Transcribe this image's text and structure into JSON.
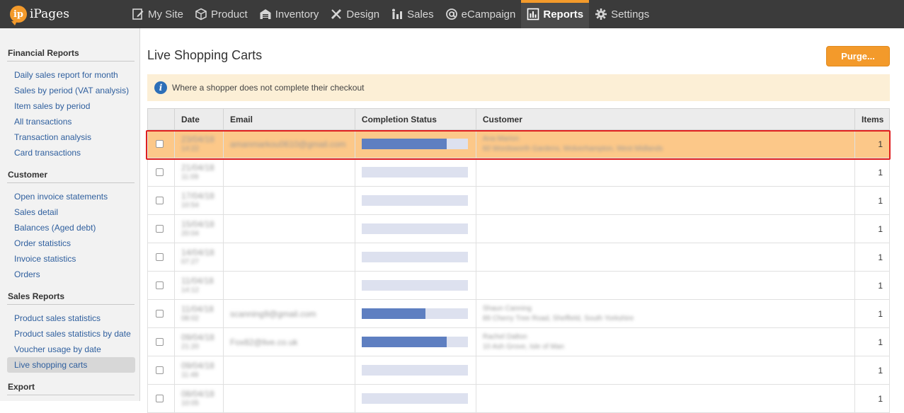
{
  "app": {
    "name": "iPages",
    "logo_initials": "ip"
  },
  "nav": [
    {
      "label": "My Site",
      "icon": "edit-page-icon"
    },
    {
      "label": "Product",
      "icon": "box-icon"
    },
    {
      "label": "Inventory",
      "icon": "warehouse-icon"
    },
    {
      "label": "Design",
      "icon": "pencil-ruler-icon"
    },
    {
      "label": "Sales",
      "icon": "sales-icon"
    },
    {
      "label": "eCampaign",
      "icon": "at-sign-icon"
    },
    {
      "label": "Reports",
      "icon": "bar-chart-icon",
      "active": true
    },
    {
      "label": "Settings",
      "icon": "gear-icon"
    }
  ],
  "sidebar": {
    "sections": [
      {
        "heading": "Financial Reports",
        "items": [
          "Daily sales report for month",
          "Sales by period (VAT analysis)",
          "Item sales by period",
          "All transactions",
          "Transaction analysis",
          "Card transactions"
        ]
      },
      {
        "heading": "Customer",
        "items": [
          "Open invoice statements",
          "Sales detail",
          "Balances (Aged debt)",
          "Order statistics",
          "Invoice statistics",
          "Orders"
        ]
      },
      {
        "heading": "Sales Reports",
        "items": [
          "Product sales statistics",
          "Product sales statistics by date",
          "Voucher usage by date",
          "Live shopping carts"
        ]
      },
      {
        "heading": "Export",
        "items": []
      }
    ],
    "active_item": "Live shopping carts"
  },
  "main": {
    "title": "Live Shopping Carts",
    "purge_label": "Purge...",
    "info_text": "Where a shopper does not complete their checkout",
    "columns": [
      "",
      "Date",
      "Email",
      "Completion Status",
      "Customer",
      "Items"
    ],
    "rows": [
      {
        "date": "23/04/18",
        "time": "14:22",
        "email": "amanmarkou0610@gmail.com",
        "completion": 0.8,
        "customer_name": "Ana Marion",
        "customer_addr": "60 Wordsworth Gardens, Wolverhampton, West Midlands",
        "items": "1",
        "highlight": true
      },
      {
        "date": "21/04/18",
        "time": "11:09",
        "email": "",
        "completion": 0,
        "customer_name": "",
        "customer_addr": "",
        "items": "1"
      },
      {
        "date": "17/04/18",
        "time": "10:54",
        "email": "",
        "completion": 0,
        "customer_name": "",
        "customer_addr": "",
        "items": "1"
      },
      {
        "date": "15/04/18",
        "time": "20:04",
        "email": "",
        "completion": 0,
        "customer_name": "",
        "customer_addr": "",
        "items": "1"
      },
      {
        "date": "14/04/18",
        "time": "07:27",
        "email": "",
        "completion": 0,
        "customer_name": "",
        "customer_addr": "",
        "items": "1"
      },
      {
        "date": "11/04/18",
        "time": "14:12",
        "email": "",
        "completion": 0,
        "customer_name": "",
        "customer_addr": "",
        "items": "1"
      },
      {
        "date": "11/04/18",
        "time": "08:02",
        "email": "scanning9@gmail.com",
        "completion": 0.6,
        "customer_name": "Shaun Canning",
        "customer_addr": "89 Cherry Tree Road, Sheffield, South Yorkshire",
        "items": "1"
      },
      {
        "date": "09/04/18",
        "time": "21:20",
        "email": "Fox82@live.co.uk",
        "completion": 0.8,
        "customer_name": "Rachel Dalton",
        "customer_addr": "10 Ash Grove, Isle of Man",
        "items": "1"
      },
      {
        "date": "09/04/18",
        "time": "11:48",
        "email": "",
        "completion": 0,
        "customer_name": "",
        "customer_addr": "",
        "items": "1"
      },
      {
        "date": "08/04/18",
        "time": "10:05",
        "email": "",
        "completion": 0,
        "customer_name": "",
        "customer_addr": "",
        "items": "1"
      }
    ]
  },
  "colors": {
    "accent": "#f39a2b",
    "topbar": "#3b3b3b",
    "highlight_row": "#fcc889",
    "progress_fill": "#5e7fc1",
    "progress_track": "#dde1ef",
    "link": "#2f5f9e",
    "outline": "#e01f1f"
  }
}
